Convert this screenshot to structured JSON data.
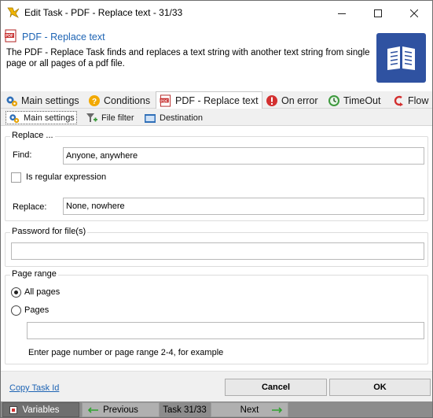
{
  "window": {
    "title": "Edit Task - PDF - Replace text - 31/33",
    "app_icon": "lightning-icon",
    "controls": {
      "minimize_icon": "minimize-icon",
      "maximize_icon": "maximize-icon",
      "close_icon": "close-icon"
    }
  },
  "header": {
    "title": "PDF - Replace text",
    "description": "The PDF - Replace Task finds and replaces a text string with another text string from single page or all pages of a pdf file.",
    "icon": "pdf-icon",
    "big_icon": "book-icon",
    "accent": "#2f52a1",
    "title_color": "#1e64b4"
  },
  "main_tabs": [
    {
      "label": "Main settings",
      "icon": "gears-icon",
      "active": false
    },
    {
      "label": "Conditions",
      "icon": "question-icon",
      "active": false
    },
    {
      "label": "PDF - Replace text",
      "icon": "pdf-icon",
      "active": true
    },
    {
      "label": "On error",
      "icon": "error-icon",
      "active": false
    },
    {
      "label": "TimeOut",
      "icon": "clock-icon",
      "active": false
    },
    {
      "label": "Flow",
      "icon": "flow-icon",
      "active": false
    }
  ],
  "sub_tabs": [
    {
      "label": "Main settings",
      "icon": "gears-icon",
      "active": true
    },
    {
      "label": "File filter",
      "icon": "filter-icon",
      "active": false
    },
    {
      "label": "Destination",
      "icon": "folder-icon",
      "active": false
    }
  ],
  "replace_group": {
    "legend": "Replace ...",
    "find_label": "Find:",
    "find_value": "Anyone, anywhere",
    "regex_label": "Is regular expression",
    "regex_checked": false,
    "replace_label": "Replace:",
    "replace_value": "None, nowhere"
  },
  "password_group": {
    "legend": "Password for file(s)",
    "value": ""
  },
  "page_range_group": {
    "legend": "Page range",
    "all_pages_label": "All pages",
    "pages_label": "Pages",
    "selected": "All pages",
    "pages_value": "",
    "hint": "Enter page number or page range 2-4, for example"
  },
  "footer": {
    "copy_link": "Copy Task Id",
    "cancel_label": "Cancel",
    "ok_label": "OK"
  },
  "statusbar": {
    "variables_label": "Variables",
    "previous_label": "Previous",
    "task_counter": "Task 31/33",
    "next_label": "Next"
  }
}
